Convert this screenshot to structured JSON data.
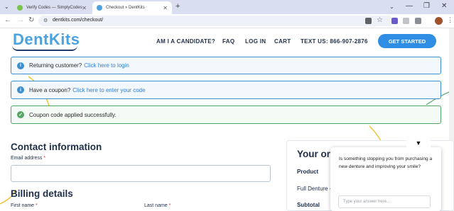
{
  "browser": {
    "tabs": [
      {
        "title": "Verify Codes — SimplyCodes",
        "active": false,
        "favicon_color": "#7bc24a"
      },
      {
        "title": "Checkout » DentKits",
        "active": true,
        "favicon_color": "#4aa3df"
      }
    ],
    "new_tab_symbol": "+",
    "url": "dentkits.com/checkout/",
    "window_controls": [
      "⌄",
      "—",
      "❐",
      "✕"
    ]
  },
  "site": {
    "logo": "DentKits",
    "nav": [
      "AM I A CANDIDATE?",
      "FAQ",
      "LOG IN",
      "CART",
      "TEXT US: 866-907-2876"
    ],
    "cta_label": "GET STARTED"
  },
  "notices": {
    "returning": {
      "text": "Returning customer?",
      "link": "Click here to login"
    },
    "coupon": {
      "text": "Have a coupon?",
      "link": "Click here to enter your code"
    },
    "success": {
      "text": "Coupon code applied successfully."
    }
  },
  "form": {
    "contact_heading": "Contact information",
    "email_label": "Email address",
    "required_mark": "*",
    "email_value": "",
    "billing_heading": "Billing details",
    "first_name_label": "First name",
    "last_name_label": "Last name"
  },
  "order": {
    "title": "Your ord",
    "product_header": "Product",
    "product_name": "Full Denture -",
    "subtotal_label": "Subtotal"
  },
  "chat": {
    "toggle_symbol": "▼",
    "question": "Is something stopping you from purchasing a new denture and improving your smile?",
    "placeholder": "Type your answer here..."
  },
  "colors": {
    "brand_blue": "#4aa3df",
    "cta_blue": "#2f8de4",
    "navy": "#1f2f4a",
    "info_border": "#3d8fce",
    "success_border": "#56a665"
  }
}
